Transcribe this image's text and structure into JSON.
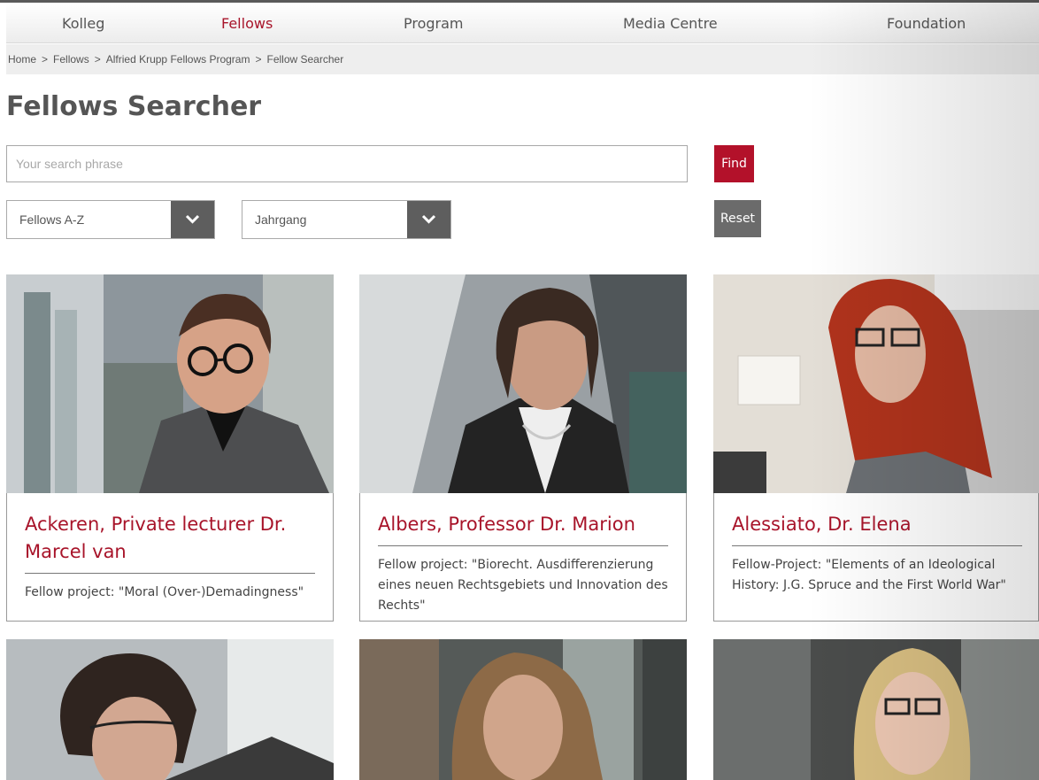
{
  "nav": {
    "items": [
      "Kolleg",
      "Fellows",
      "Program",
      "Media Centre",
      "Foundation"
    ],
    "active": "Fellows"
  },
  "breadcrumb": [
    "Home",
    "Fellows",
    "Alfried Krupp Fellows Program",
    "Fellow Searcher"
  ],
  "breadcrumb_separator": ">",
  "page_title": "Fellows Searcher",
  "search": {
    "placeholder": "Your search phrase",
    "value": ""
  },
  "buttons": {
    "find": "Find",
    "reset": "Reset"
  },
  "filters": {
    "sort": "Fellows A-Z",
    "year": "Jahrgang"
  },
  "colors": {
    "accent": "#a8142a",
    "button_gray": "#6b6b6b",
    "select_arrow": "#5e5e5e"
  },
  "fellows": [
    {
      "name": "Ackeren, Private lecturer Dr. Marcel van",
      "project": "Fellow project: \"Moral (Over-)Demadingness\""
    },
    {
      "name": "Albers, Professor Dr. Marion",
      "project": "Fellow project: \"Biorecht. Ausdifferenzierung eines neuen Rechtsgebiets und Innovation des Rechts\""
    },
    {
      "name": "Alessiato, Dr. Elena",
      "project": "Fellow-Project: \"Elements of an Ideological History: J.G. Spruce and the First World War\""
    }
  ]
}
